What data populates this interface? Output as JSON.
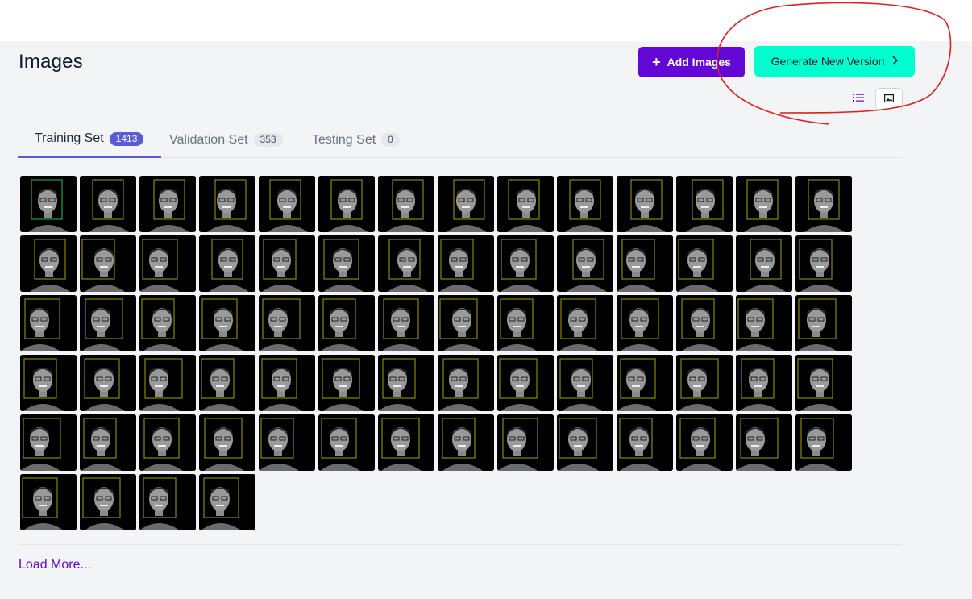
{
  "page": {
    "title": "Images"
  },
  "actions": {
    "add_images_label": "Add Images",
    "add_images_icon": "plus-icon",
    "generate_label": "Generate New Version",
    "generate_icon": "chevron-right-icon"
  },
  "view_toggle": {
    "list_icon": "list-icon",
    "grid_icon": "image-icon",
    "selected": "grid"
  },
  "tabs": [
    {
      "label": "Training Set",
      "count": "1413",
      "active": true
    },
    {
      "label": "Validation Set",
      "count": "353",
      "active": false
    },
    {
      "label": "Testing Set",
      "count": "0",
      "active": false
    }
  ],
  "gallery": {
    "image_count": 74,
    "first_box_color": "#22c55e",
    "box_color": "#a3a300",
    "thumbnail_background": "#000000"
  },
  "load_more": {
    "label": "Load More..."
  },
  "colors": {
    "primary": "#6406d6",
    "accent": "#00ffcf",
    "tab_indicator": "#5b5bd6",
    "annotation": "#e11d1d"
  }
}
